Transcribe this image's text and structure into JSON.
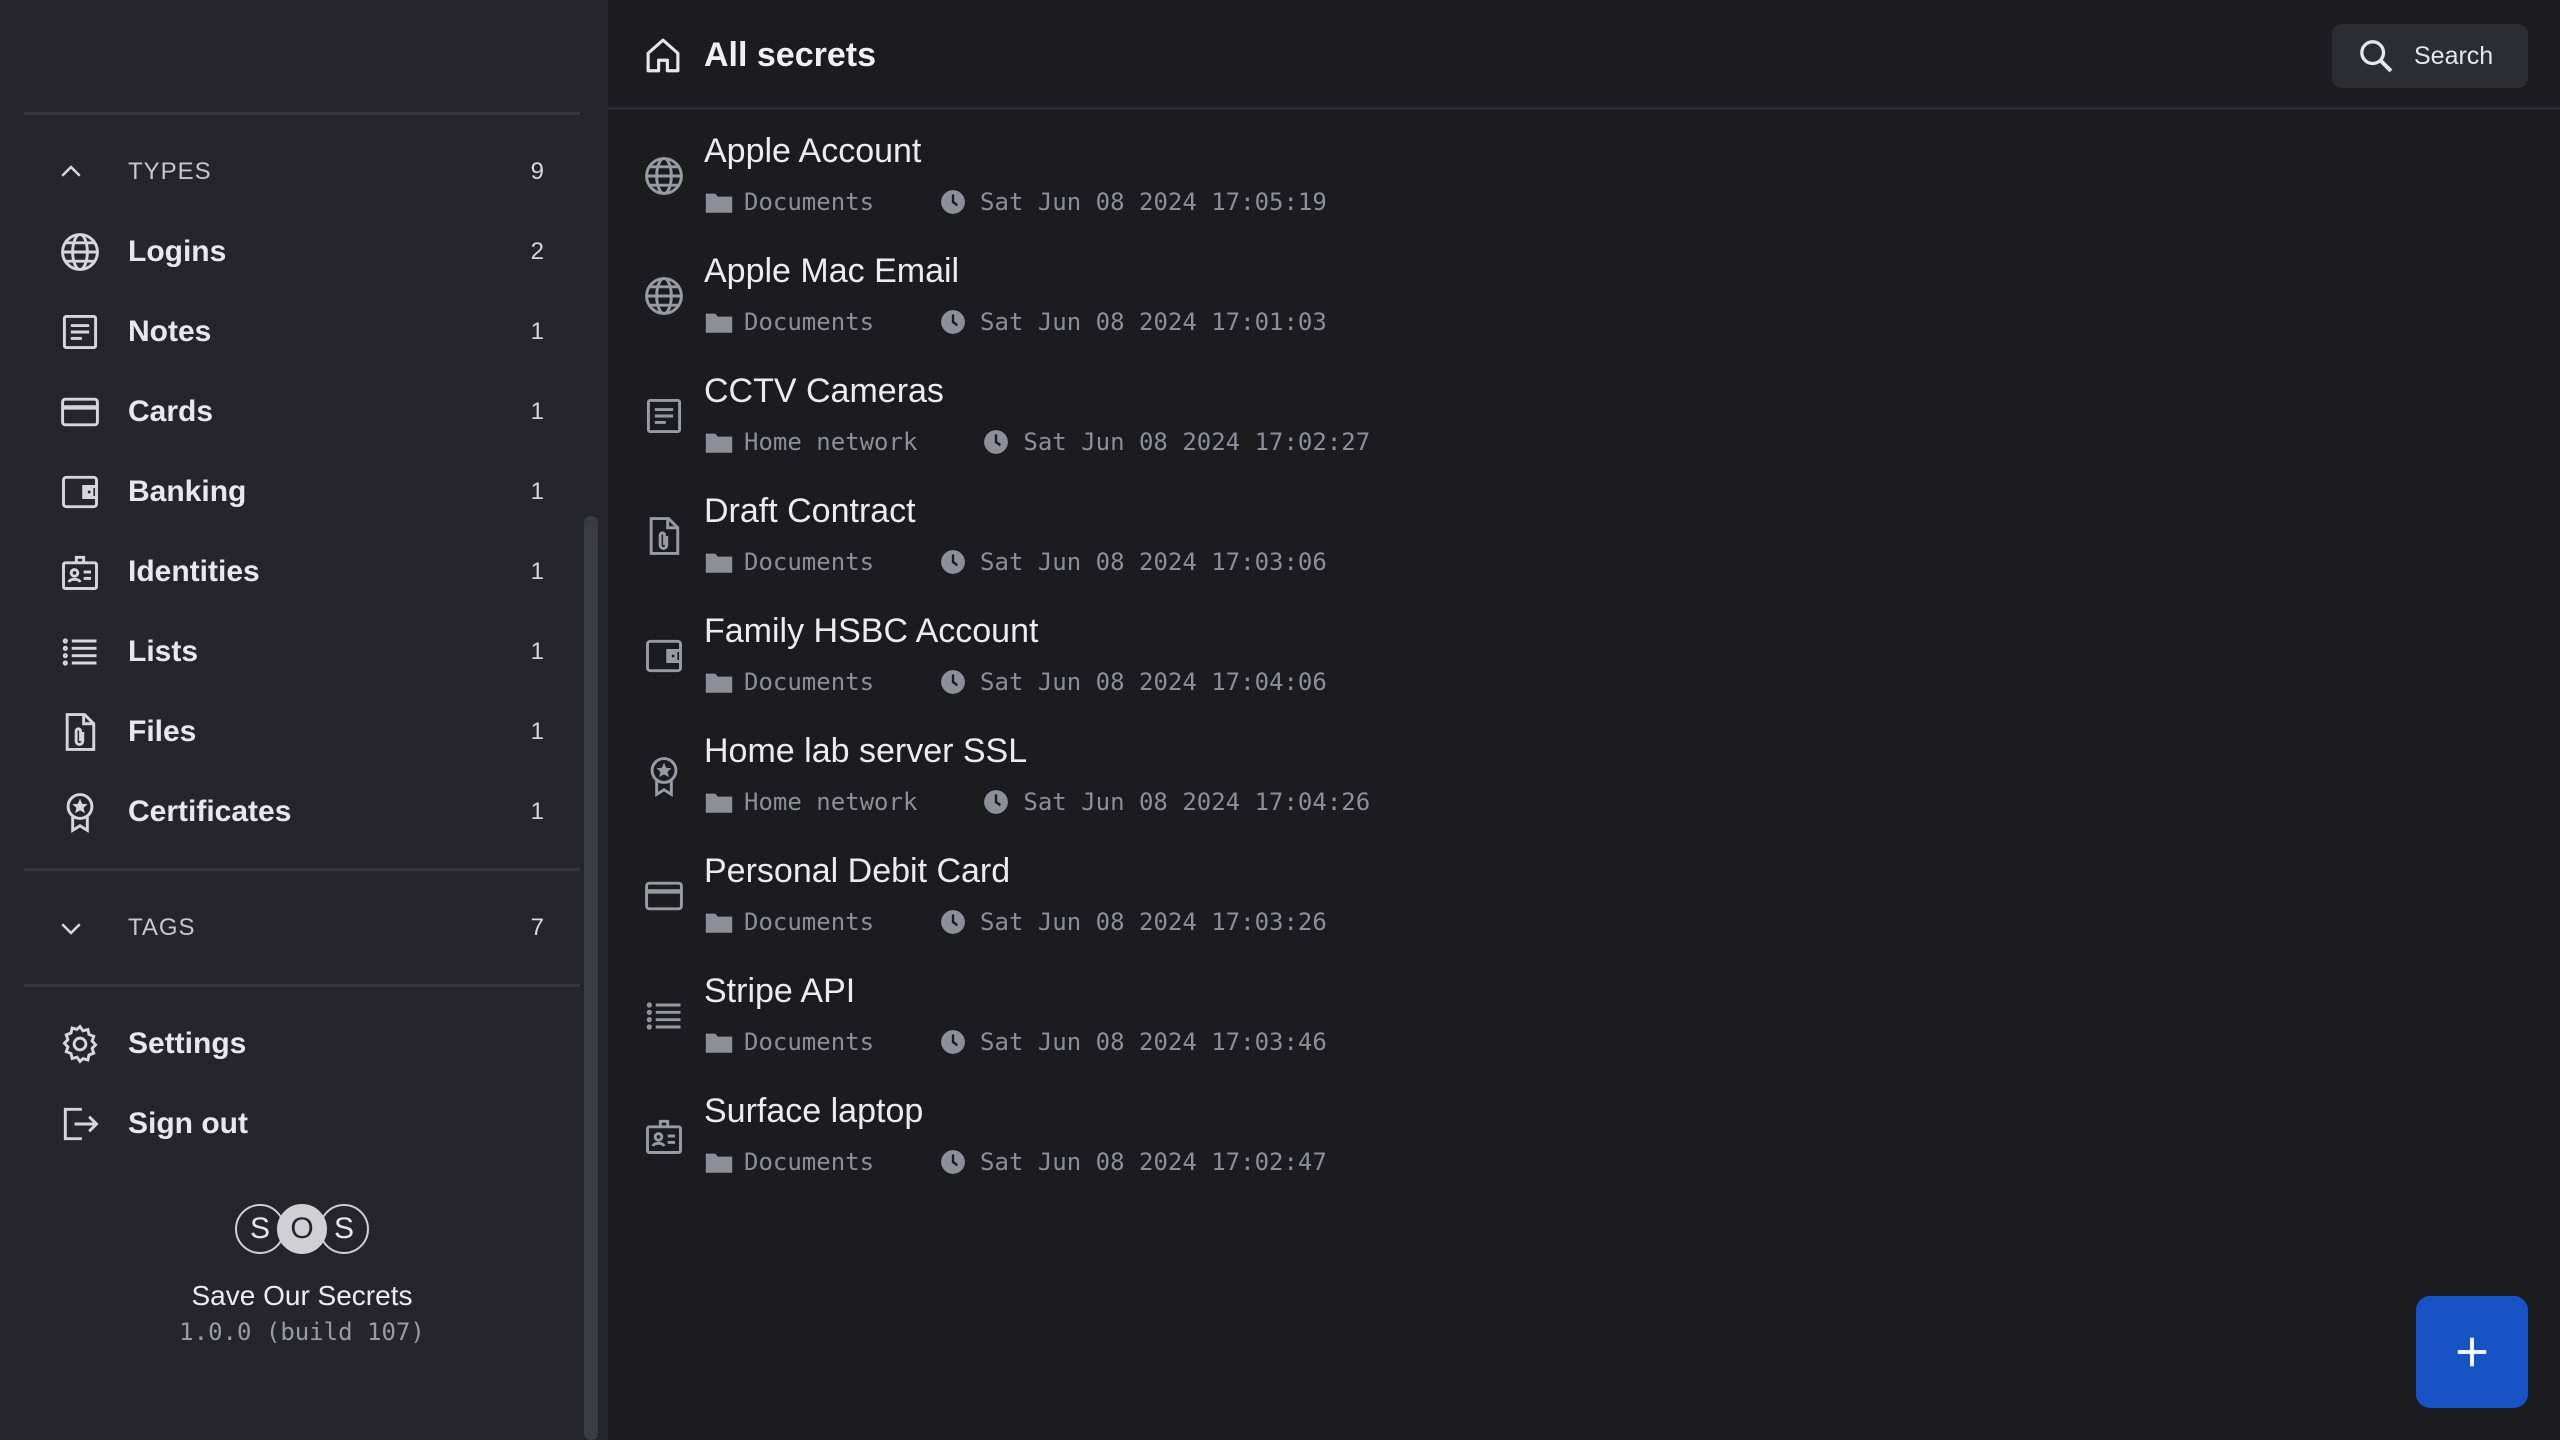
{
  "sidebar": {
    "types": {
      "label": "TYPES",
      "count": "9"
    },
    "items": [
      {
        "label": "Logins",
        "count": "2",
        "icon": "globe-icon"
      },
      {
        "label": "Notes",
        "count": "1",
        "icon": "note-icon"
      },
      {
        "label": "Cards",
        "count": "1",
        "icon": "card-icon"
      },
      {
        "label": "Banking",
        "count": "1",
        "icon": "wallet-icon"
      },
      {
        "label": "Identities",
        "count": "1",
        "icon": "id-badge-icon"
      },
      {
        "label": "Lists",
        "count": "1",
        "icon": "list-icon"
      },
      {
        "label": "Files",
        "count": "1",
        "icon": "file-clip-icon"
      },
      {
        "label": "Certificates",
        "count": "1",
        "icon": "award-icon"
      }
    ],
    "tags": {
      "label": "TAGS",
      "count": "7"
    },
    "settings_label": "Settings",
    "signout_label": "Sign out",
    "brand": {
      "logo_letters": [
        "S",
        "O",
        "S"
      ],
      "name": "Save Our Secrets",
      "version": "1.0.0 (build 107)"
    }
  },
  "header": {
    "title": "All secrets",
    "search_label": "Search"
  },
  "secrets": [
    {
      "name": "Apple Account",
      "folder": "Documents",
      "date": "Sat Jun 08 2024 17:05:19",
      "icon": "globe-icon"
    },
    {
      "name": "Apple Mac Email",
      "folder": "Documents",
      "date": "Sat Jun 08 2024 17:01:03",
      "icon": "globe-icon"
    },
    {
      "name": "CCTV Cameras",
      "folder": "Home network",
      "date": "Sat Jun 08 2024 17:02:27",
      "icon": "note-icon"
    },
    {
      "name": "Draft Contract",
      "folder": "Documents",
      "date": "Sat Jun 08 2024 17:03:06",
      "icon": "file-clip-icon"
    },
    {
      "name": "Family HSBC Account",
      "folder": "Documents",
      "date": "Sat Jun 08 2024 17:04:06",
      "icon": "wallet-icon"
    },
    {
      "name": "Home lab server SSL",
      "folder": "Home network",
      "date": "Sat Jun 08 2024 17:04:26",
      "icon": "award-icon"
    },
    {
      "name": "Personal Debit Card",
      "folder": "Documents",
      "date": "Sat Jun 08 2024 17:03:26",
      "icon": "card-icon"
    },
    {
      "name": "Stripe API",
      "folder": "Documents",
      "date": "Sat Jun 08 2024 17:03:46",
      "icon": "list-icon"
    },
    {
      "name": "Surface laptop",
      "folder": "Documents",
      "date": "Sat Jun 08 2024 17:02:47",
      "icon": "id-badge-icon"
    }
  ],
  "colors": {
    "sidebar_bg": "#25252b",
    "main_bg": "#1b1b20",
    "accent": "#1853c5"
  }
}
